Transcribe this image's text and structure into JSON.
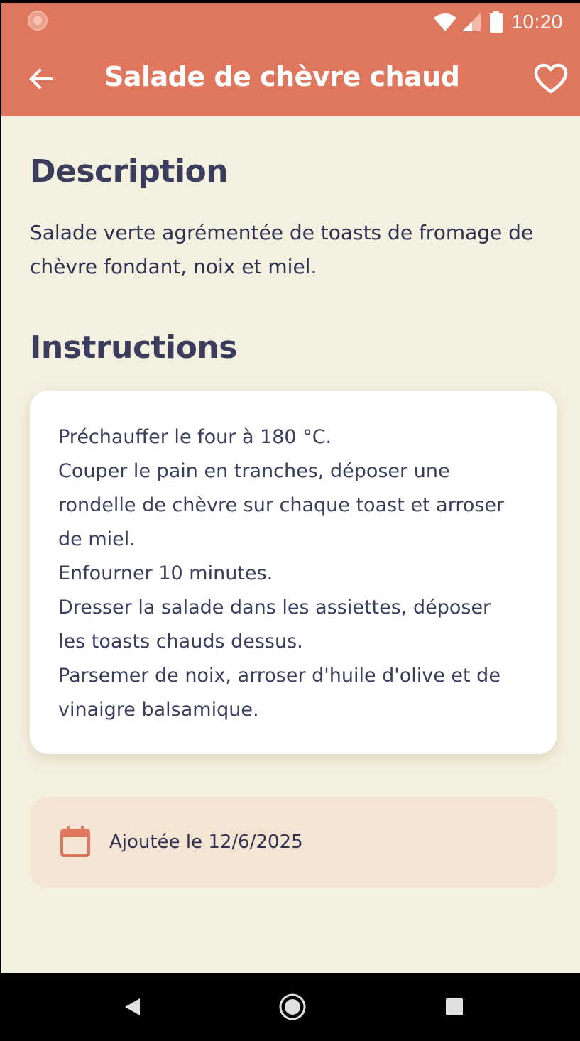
{
  "status_bar": {
    "time": "10:20",
    "icons": [
      "notification-dot-icon",
      "wifi-icon",
      "signal-icon",
      "battery-icon"
    ]
  },
  "app_bar": {
    "title": "Salade de chèvre chaud",
    "back_icon": "arrow-back-icon",
    "favorite_icon": "heart-outline-icon"
  },
  "description": {
    "heading": "Description",
    "text": "Salade verte agrémentée de toasts de fromage de chèvre fondant, noix et miel."
  },
  "instructions": {
    "heading": "Instructions",
    "lines": [
      "Préchauffer le four à 180 °C.",
      "Couper le pain en tranches, déposer une",
      "rondelle de chèvre sur chaque toast et arroser",
      "de miel.",
      "Enfourner 10 minutes.",
      "Dresser la salade dans les assiettes, déposer",
      "les toasts chauds dessus.",
      "Parsemer de noix, arroser d'huile d'olive et de",
      "vinaigre balsamique."
    ]
  },
  "added": {
    "icon": "calendar-icon",
    "text": "Ajoutée le 12/6/2025"
  },
  "nav_bar": {
    "icons": [
      "back-triangle-icon",
      "home-circle-icon",
      "recents-square-icon"
    ]
  },
  "colors": {
    "primary": "#DE775E",
    "background": "#F4F0DF",
    "heading": "#3A3D5C",
    "card": "#FFFFFF",
    "date_card": "#F3E4D4"
  }
}
